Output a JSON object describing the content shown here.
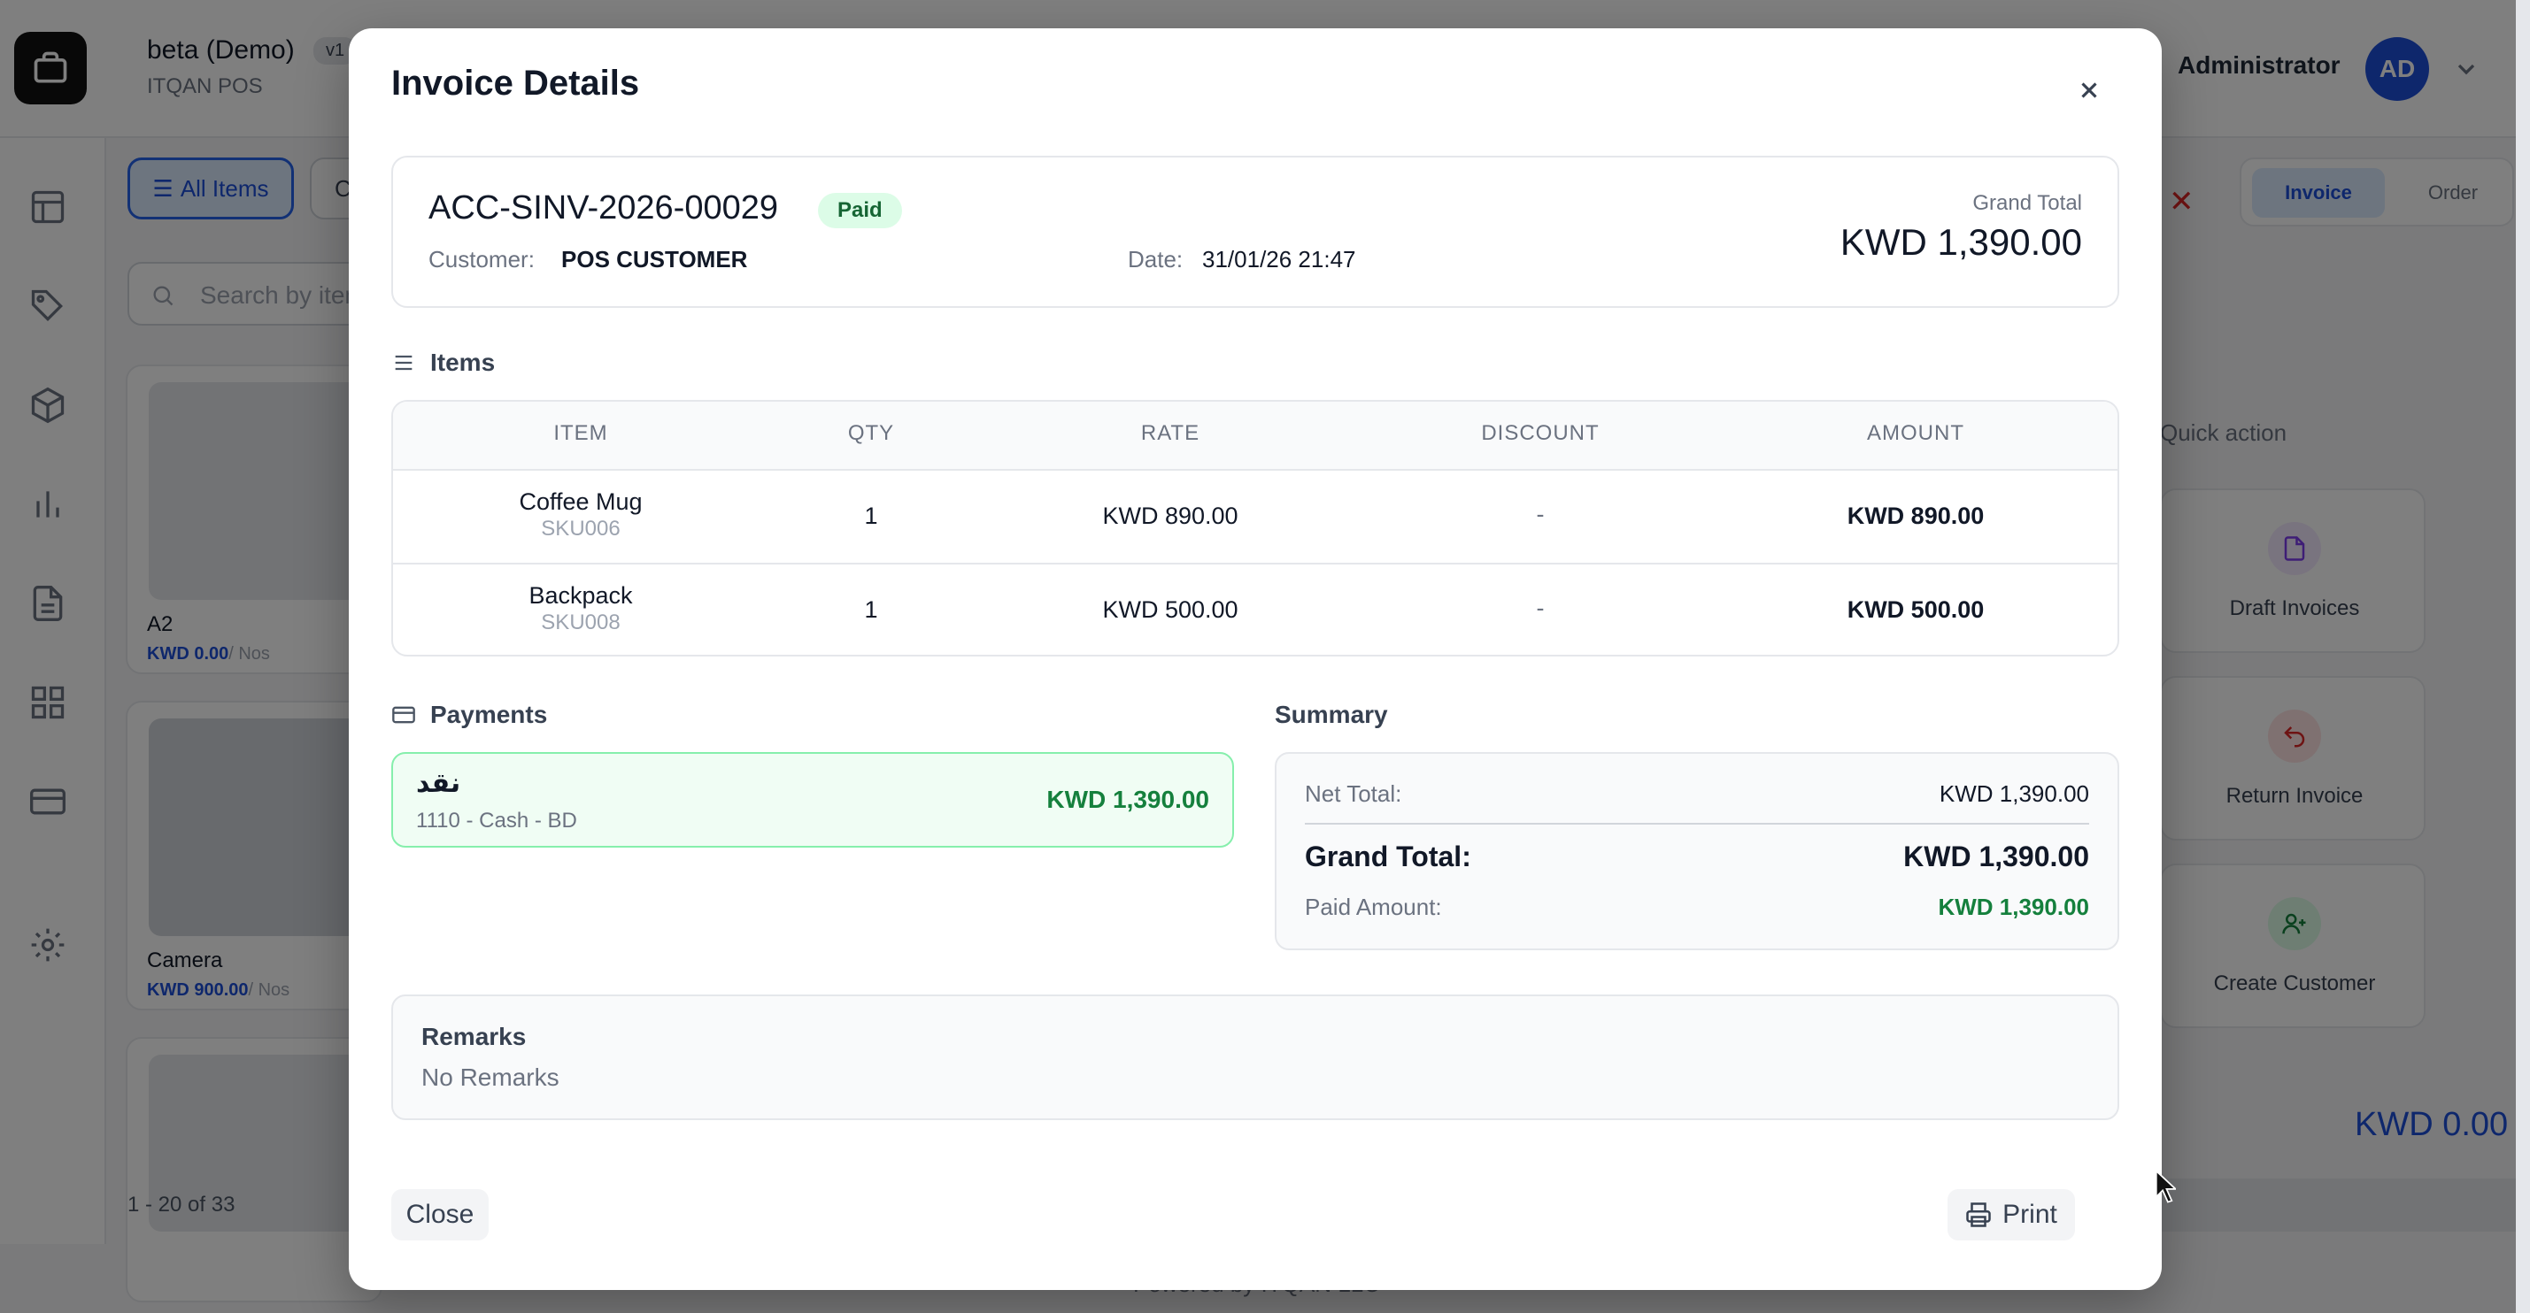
{
  "app": {
    "title": "beta (Demo)",
    "version": "v1",
    "subtitle": "ITQAN POS",
    "user_name": "Administrator",
    "user_initials": "AD"
  },
  "colors": {
    "accent": "#1d4ed8",
    "paid_green": "#15803d",
    "danger": "#dc2626"
  },
  "background": {
    "all_items_label": "All Items",
    "category_2_label": "C",
    "search_placeholder": "Search by item",
    "items": [
      {
        "name": "A2",
        "price": "KWD 0.00",
        "uom": "/ Nos"
      },
      {
        "name": "Camera",
        "price": "KWD 900.00",
        "uom": "/ Nos"
      }
    ],
    "pager": "1 - 20 of 33",
    "footer": "Powered by ITQAN LLC",
    "tab_invoice": "Invoice",
    "tab_order": "Order",
    "quick_action_title": "Quick action",
    "quick_actions": [
      {
        "label": "Draft Invoices",
        "icon": "document-icon"
      },
      {
        "label": "Return Invoice",
        "icon": "undo-icon"
      },
      {
        "label": "Create Customer",
        "icon": "user-plus-icon"
      }
    ],
    "cart_total": "KWD 0.00"
  },
  "modal": {
    "title": "Invoice Details",
    "invoice_no": "ACC-SINV-2026-00029",
    "status": "Paid",
    "customer_label": "Customer:",
    "customer": "POS CUSTOMER",
    "date_label": "Date:",
    "date": "31/01/26 21:47",
    "grand_total_label": "Grand Total",
    "grand_total": "KWD 1,390.00",
    "items_heading": "Items",
    "columns": [
      "ITEM",
      "QTY",
      "RATE",
      "DISCOUNT",
      "AMOUNT"
    ],
    "rows": [
      {
        "item": "Coffee Mug",
        "sku": "SKU006",
        "qty": "1",
        "rate": "KWD 890.00",
        "discount": "-",
        "amount": "KWD 890.00"
      },
      {
        "item": "Backpack",
        "sku": "SKU008",
        "qty": "1",
        "rate": "KWD 500.00",
        "discount": "-",
        "amount": "KWD 500.00"
      }
    ],
    "payments_heading": "Payments",
    "payment": {
      "mode": "نقد",
      "account": "1110 - Cash - BD",
      "amount": "KWD 1,390.00"
    },
    "summary_heading": "Summary",
    "summary": {
      "net_total_label": "Net Total:",
      "net_total": "KWD 1,390.00",
      "grand_total_label": "Grand Total:",
      "grand_total": "KWD 1,390.00",
      "paid_label": "Paid Amount:",
      "paid": "KWD 1,390.00"
    },
    "remarks_heading": "Remarks",
    "remarks": "No Remarks",
    "close_label": "Close",
    "print_label": "Print"
  }
}
